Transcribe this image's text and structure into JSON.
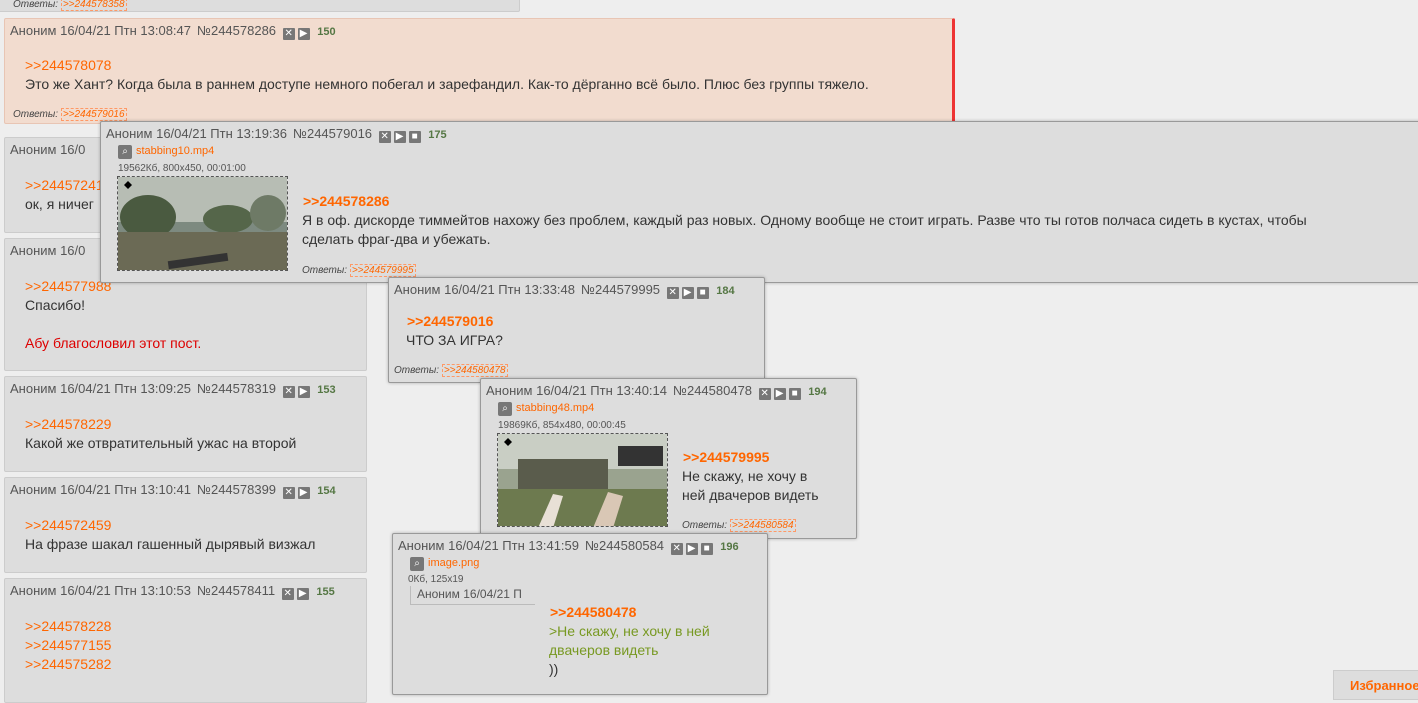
{
  "top_partial": {
    "label": "Ответы:",
    "link": ">>244578358"
  },
  "posts": [
    {
      "author": "Аноним",
      "date": "16/04/21 Птн 13:08:47",
      "id": "№244578286",
      "count": "150",
      "ref": ">>244578078",
      "text": "Это же Хант? Когда была в раннем доступе немного побегал и зарефандил. Как-то дёрганно всё было. Плюс без группы тяжело.",
      "replies_label": "Ответы:",
      "reply_link": ">>244579016"
    },
    {
      "author": "Аноним",
      "date": "16/04/21 Птн 13:19:36",
      "id": "№244579016",
      "count": "175",
      "file_name": "stabbing10.mp4",
      "file_meta": "19562Кб, 800x450, 00:01:00",
      "ref": ">>244578286",
      "text_line1": "Я в оф. дискорде тиммейтов нахожу без проблем, каждый раз новых. Одному вообще не стоит играть. Разве что ты готов полчаса сидеть в кустах, чтобы",
      "text_line2": "сделать фраг-два и убежать.",
      "replies_label": "Ответы:",
      "reply_link": ">>244579995"
    },
    {
      "author": "Аноним",
      "date": "16/04/21 Птн 13:33:48",
      "id": "№244579995",
      "count": "184",
      "ref": ">>244579016",
      "text": "ЧТО ЗА ИГРА?",
      "replies_label": "Ответы:",
      "reply_link": ">>244580478"
    },
    {
      "author": "Аноним",
      "date": "16/04/21 Птн 13:40:14",
      "id": "№244580478",
      "count": "194",
      "file_name": "stabbing48.mp4",
      "file_meta": "19869Кб, 854x480, 00:00:45",
      "ref": ">>244579995",
      "text_line1": "Не скажу, не хочу в",
      "text_line2": "ней двачеров видеть",
      "replies_label": "Ответы:",
      "reply_link": ">>244580584"
    },
    {
      "author": "Аноним",
      "date": "16/04/21 Птн 13:41:59",
      "id": "№244580584",
      "count": "196",
      "file_name": "image.png",
      "file_meta": "0Кб, 125x19",
      "thumb_text": "Аноним 16/04/21 П",
      "ref": ">>244580478",
      "quote_line1": ">Не скажу, не хочу в ней",
      "quote_line2": "двачеров видеть",
      "text": "))"
    }
  ],
  "left_posts": [
    {
      "head": "Аноним 16/0",
      "ref": ">>24457241",
      "text": "ок, я ничег"
    },
    {
      "head": "Аноним 16/0",
      "ref": ">>244577988",
      "text": "Спасибо!",
      "red": "Абу благословил этот пост."
    },
    {
      "author": "Аноним",
      "date": "16/04/21 Птн 13:09:25",
      "id": "№244578319",
      "count": "153",
      "ref": ">>244578229",
      "text": "Какой же отвратительный ужас на второй"
    },
    {
      "author": "Аноним",
      "date": "16/04/21 Птн 13:10:41",
      "id": "№244578399",
      "count": "154",
      "ref": ">>244572459",
      "text": "На фразе шакал гашенный дырявый визжал"
    },
    {
      "author": "Аноним",
      "date": "16/04/21 Птн 13:10:53",
      "id": "№244578411",
      "count": "155",
      "refs": [
        ">>244578228",
        ">>244577155",
        ">>244575282"
      ]
    }
  ],
  "favorites_label": "Избранное",
  "icons": {
    "hide": "x-box-icon",
    "play": "play-icon",
    "stop": "square-icon",
    "search": "magnifier-icon"
  }
}
